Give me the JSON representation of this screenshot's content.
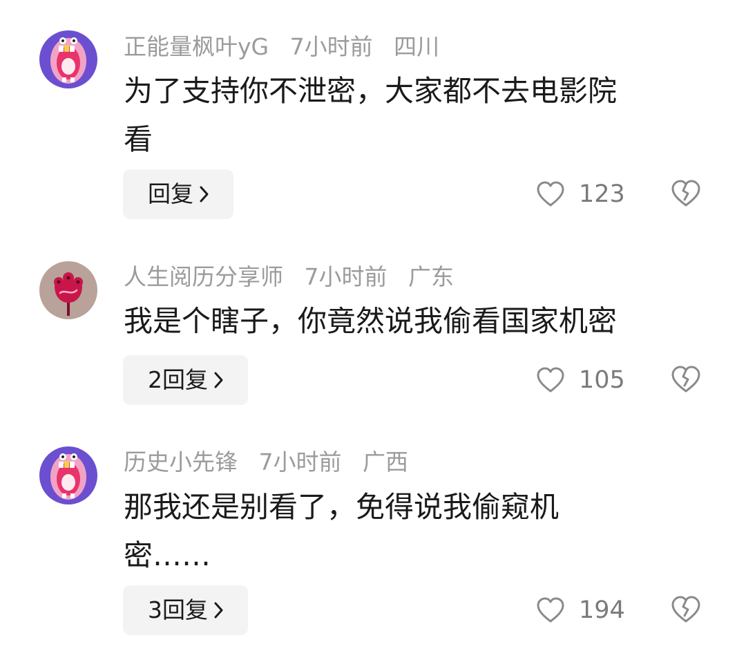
{
  "comments": [
    {
      "username": "正能量枫叶yG",
      "time": "7小时前",
      "location": "四川",
      "body_line1": "为了支持你不泄密，大家都不去电影院",
      "body_line2": "看",
      "reply_label": "回复",
      "likes": "123",
      "avatar_icon": "screaming-face-avatar-icon"
    },
    {
      "username": "人生阅历分享师",
      "time": "7小时前",
      "location": "广东",
      "body_line1": "我是个瞎子，你竟然说我偷看国家机密",
      "reply_label": "2回复",
      "likes": "105",
      "avatar_icon": "flower-avatar-icon"
    },
    {
      "username": "历史小先锋",
      "time": "7小时前",
      "location": "广西",
      "body_line1": "那我还是别看了，免得说我偷窥机",
      "body_line2": "密……",
      "reply_label": "3回复",
      "likes": "194",
      "avatar_icon": "screaming-face-avatar-icon"
    }
  ],
  "colors": {
    "meta_text": "#9b9b9b",
    "body_text": "#1a1a1a",
    "reply_bg": "#f3f3f3",
    "icon_stroke": "#8a8a8a"
  },
  "icons": {
    "like": "heart-outline-icon",
    "dislike": "broken-heart-icon",
    "reply_chevron": "chevron-right-icon"
  }
}
